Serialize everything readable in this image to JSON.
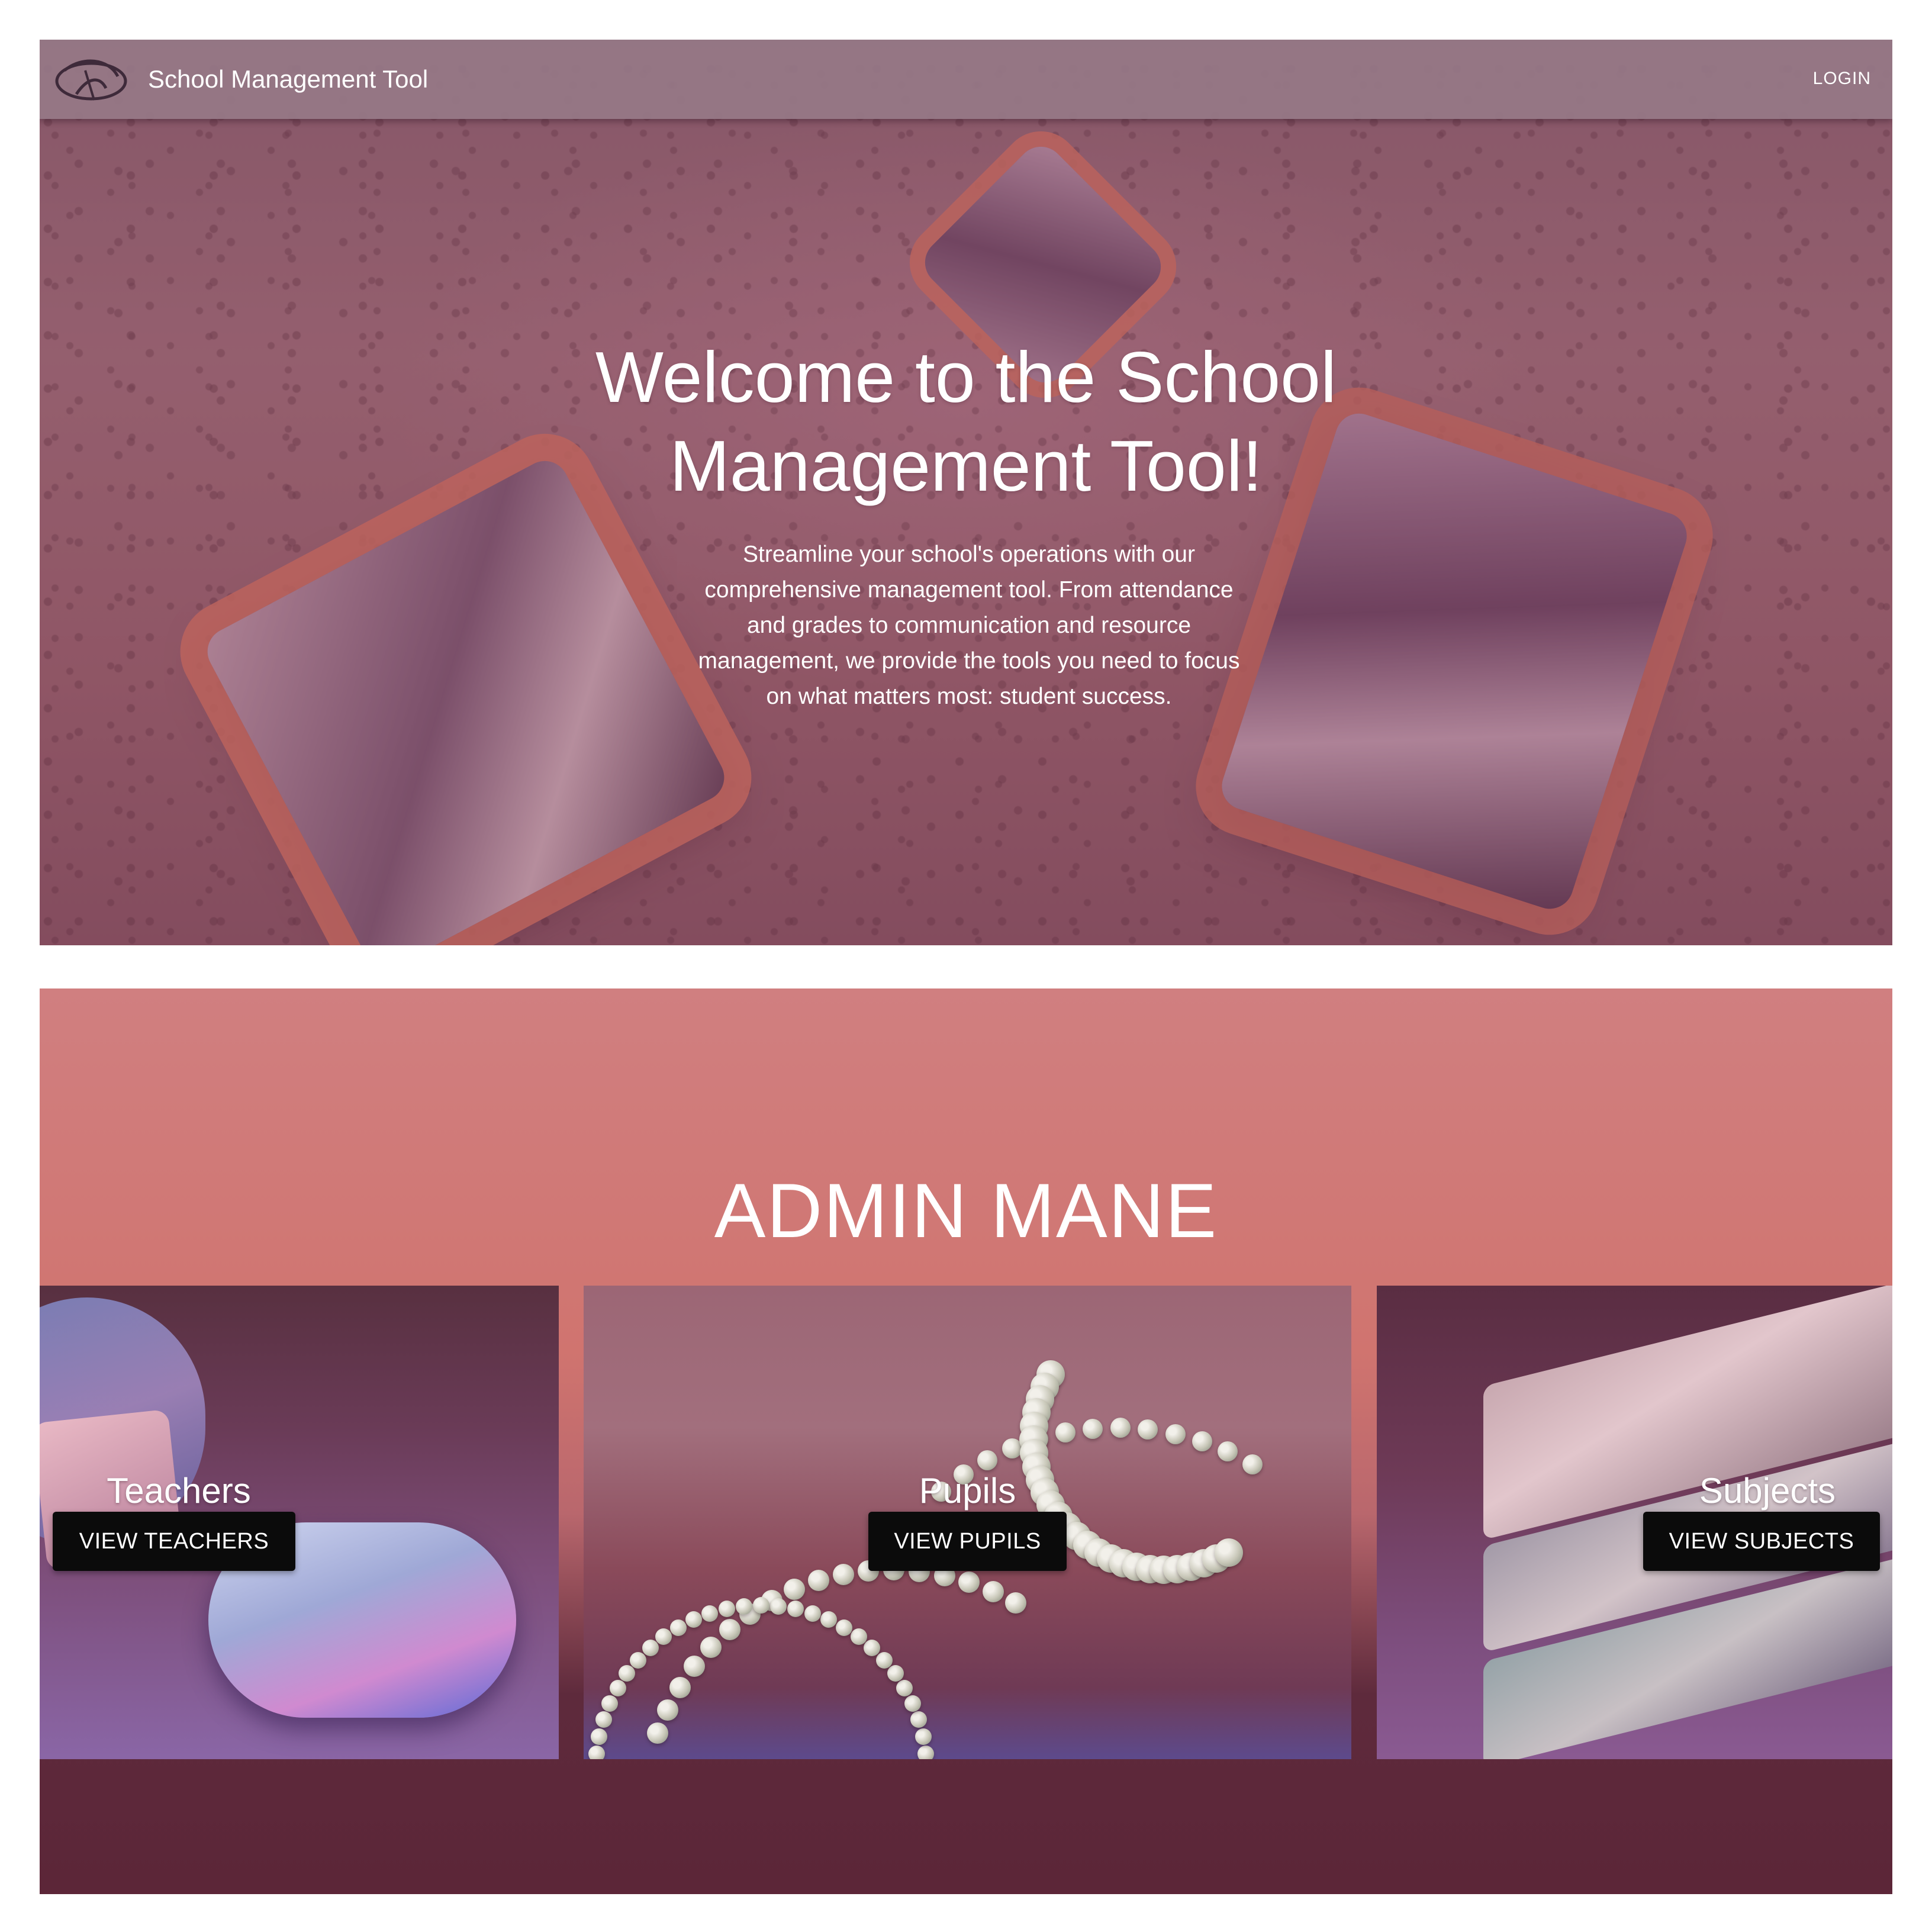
{
  "navbar": {
    "brand": "School Management Tool",
    "login_label": "LOGIN",
    "logo_icon": "swirl-logo-icon"
  },
  "hero": {
    "title_line1": "Welcome to the School",
    "title_line2": "Management Tool!",
    "subtitle": "Streamline your school's operations with our comprehensive management tool. From attendance and grades to communication and resource management, we provide the tools you need to focus on what matters most: student success."
  },
  "admin": {
    "heading": "ADMIN MANE",
    "cards": [
      {
        "label": "Teachers",
        "button": "VIEW TEACHERS"
      },
      {
        "label": "Pupils",
        "button": "VIEW PUPILS"
      },
      {
        "label": "Subjects",
        "button": "VIEW SUBJECTS"
      }
    ]
  },
  "colors": {
    "navbar": "#96788a",
    "button": "#0b0b0b",
    "admin_top": "#d07f80",
    "admin_bottom": "#5c2638"
  }
}
